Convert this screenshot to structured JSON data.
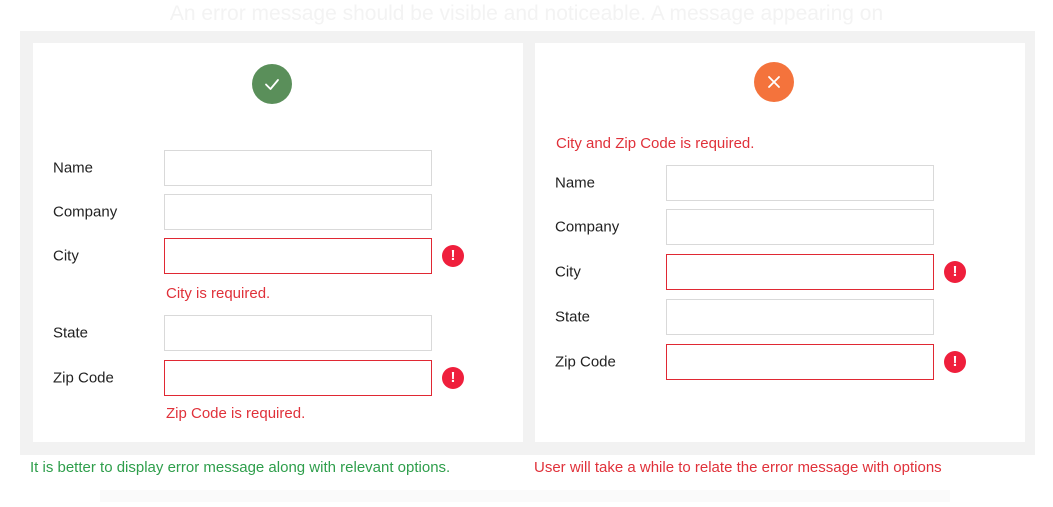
{
  "header": {
    "intro_text": "An error message should be visible and noticeable. A message appearing on"
  },
  "good_example": {
    "fields": [
      {
        "label": "Name",
        "value": "",
        "error": false
      },
      {
        "label": "Company",
        "value": "",
        "error": false
      },
      {
        "label": "City",
        "value": "",
        "error": true,
        "error_message": "City is required."
      },
      {
        "label": "State",
        "value": "",
        "error": false
      },
      {
        "label": "Zip Code",
        "value": "",
        "error": true,
        "error_message": "Zip Code is required."
      }
    ],
    "caption": "It is better to display error message along with relevant options."
  },
  "bad_example": {
    "summary_error": "City and Zip Code is required.",
    "fields": [
      {
        "label": "Name",
        "value": "",
        "error": false
      },
      {
        "label": "Company",
        "value": "",
        "error": false
      },
      {
        "label": "City",
        "value": "",
        "error": true
      },
      {
        "label": "State",
        "value": "",
        "error": false
      },
      {
        "label": "Zip Code",
        "value": "",
        "error": true
      }
    ],
    "caption": "User will take a while to relate the error message with options"
  },
  "icons": {
    "good": "checkmark-icon",
    "bad": "close-icon",
    "field_error": "exclamation-icon"
  },
  "colors": {
    "good_icon": "#5a8f5a",
    "bad_icon": "#f4733c",
    "error_text": "#e0313a",
    "error_border": "#e02833",
    "error_badge": "#ef1f3c",
    "good_caption": "#2e9e4b"
  }
}
